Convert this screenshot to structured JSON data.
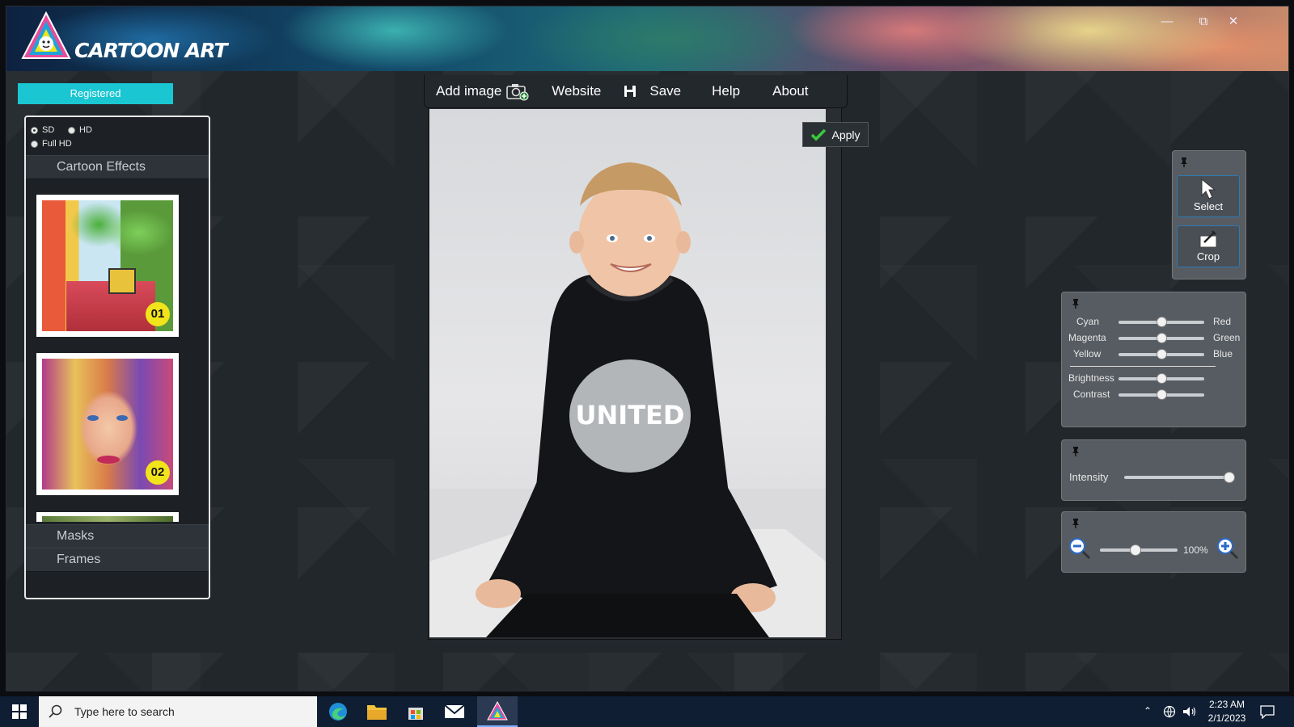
{
  "app": {
    "title": "CARTOON ART",
    "colors": {
      "accent": "#19c6d2",
      "badge": "#f2e41a",
      "select_border": "#2c7ab6"
    }
  },
  "window_controls": [
    "minimize",
    "restore",
    "close"
  ],
  "registered_label": "Registered",
  "resolution": {
    "options": [
      {
        "label": "SD",
        "selected": true
      },
      {
        "label": "HD",
        "selected": false
      },
      {
        "label": "Full HD",
        "selected": false
      }
    ]
  },
  "left_panel": {
    "effects_title": "Cartoon Effects",
    "thumbnails": [
      {
        "badge": "01"
      },
      {
        "badge": "02"
      }
    ],
    "masks_title": "Masks",
    "frames_title": "Frames"
  },
  "toolbar": {
    "add_image": "Add image",
    "website": "Website",
    "save": "Save",
    "help": "Help",
    "about": "About"
  },
  "apply_label": "Apply",
  "tools": {
    "select": "Select",
    "crop": "Crop"
  },
  "color_balance": {
    "rows": [
      {
        "left": "Cyan",
        "right": "Red",
        "value": 0.5
      },
      {
        "left": "Magenta",
        "right": "Green",
        "value": 0.5
      },
      {
        "left": "Yellow",
        "right": "Blue",
        "value": 0.5
      }
    ],
    "brightness_label": "Brightness",
    "brightness_value": 0.5,
    "contrast_label": "Contrast",
    "contrast_value": 0.5
  },
  "intensity": {
    "label": "Intensity",
    "value": 1.0
  },
  "zoom": {
    "value_text": "100%",
    "value": 0.45
  },
  "taskbar": {
    "search_placeholder": "Type here to search",
    "time": "2:23 AM",
    "date": "2/1/2023"
  }
}
